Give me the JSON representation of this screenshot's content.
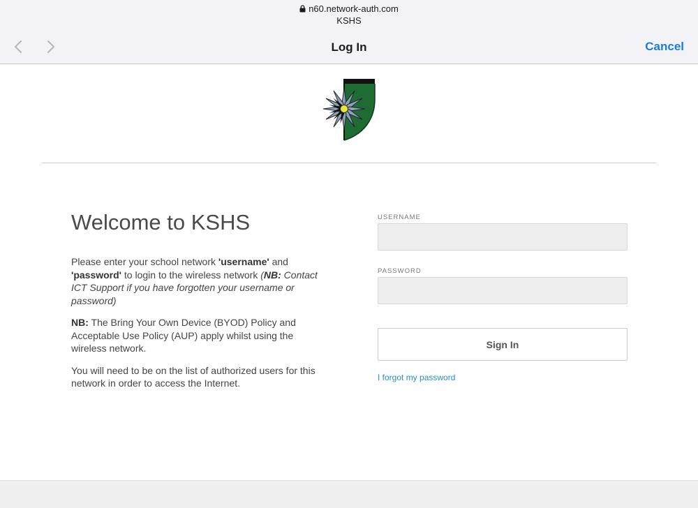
{
  "browser": {
    "url": "n60.network-auth.com",
    "site_name": "KSHS",
    "sheet_title": "Log In",
    "cancel_label": "Cancel"
  },
  "page": {
    "heading": "Welcome to KSHS",
    "para1": {
      "t1": "Please enter your school network ",
      "b1": "'username'",
      "t2": " and ",
      "b2": "'password'",
      "t3": " to login to the wireless network ",
      "i1": "(",
      "ib": "NB:",
      "i2": " Contact ICT Support if you have forgotten your username or password)"
    },
    "para2": {
      "b": "NB:",
      "t": " The Bring Your Own Device (BYOD) Policy and Acceptable Use Policy (AUP) apply whilst using the wireless network."
    },
    "para3": "You will need to be on the list of authorized users for this network in order to access the Internet.",
    "form": {
      "username_label": "USERNAME",
      "username_value": "",
      "password_label": "PASSWORD",
      "password_value": "",
      "signin_label": "Sign In",
      "forgot_label": "I forgot my password"
    }
  },
  "colors": {
    "accent_link": "#2a8bc7",
    "cancel_blue": "#1a7fd4",
    "shield_green": "#1f6b34",
    "flower_center": "#e8e832"
  },
  "icons": [
    "lock-icon",
    "chevron-left-icon",
    "chevron-right-icon",
    "school-crest-logo"
  ]
}
